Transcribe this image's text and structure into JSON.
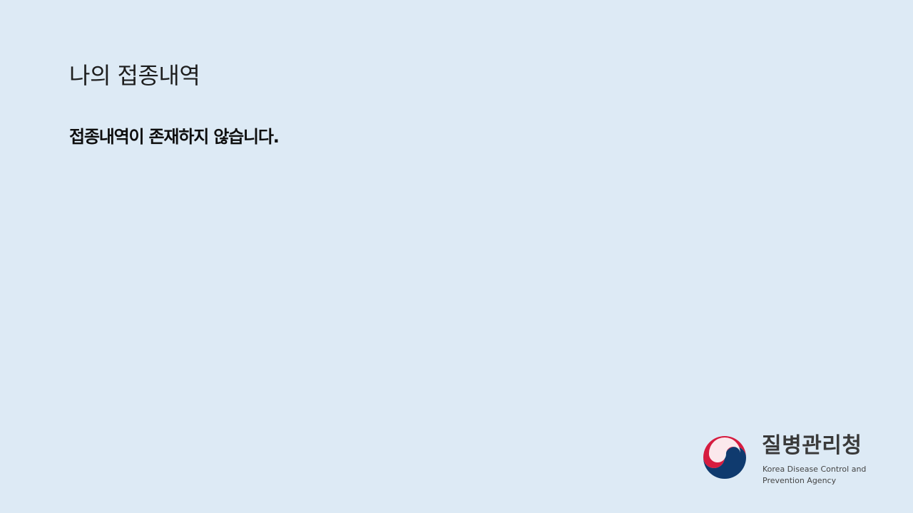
{
  "page": {
    "title": "나의 접종내역",
    "empty_message": "접종내역이 존재하지 않습니다."
  },
  "logo": {
    "name_ko": "질병관리청",
    "name_en_line1": "Korea Disease Control and",
    "name_en_line2": "Prevention Agency",
    "emblem": "taegeuk-emblem-icon"
  },
  "colors": {
    "background": "#ddeaf5",
    "emblem_red": "#d61c3f",
    "emblem_blue": "#0f3a6e"
  }
}
